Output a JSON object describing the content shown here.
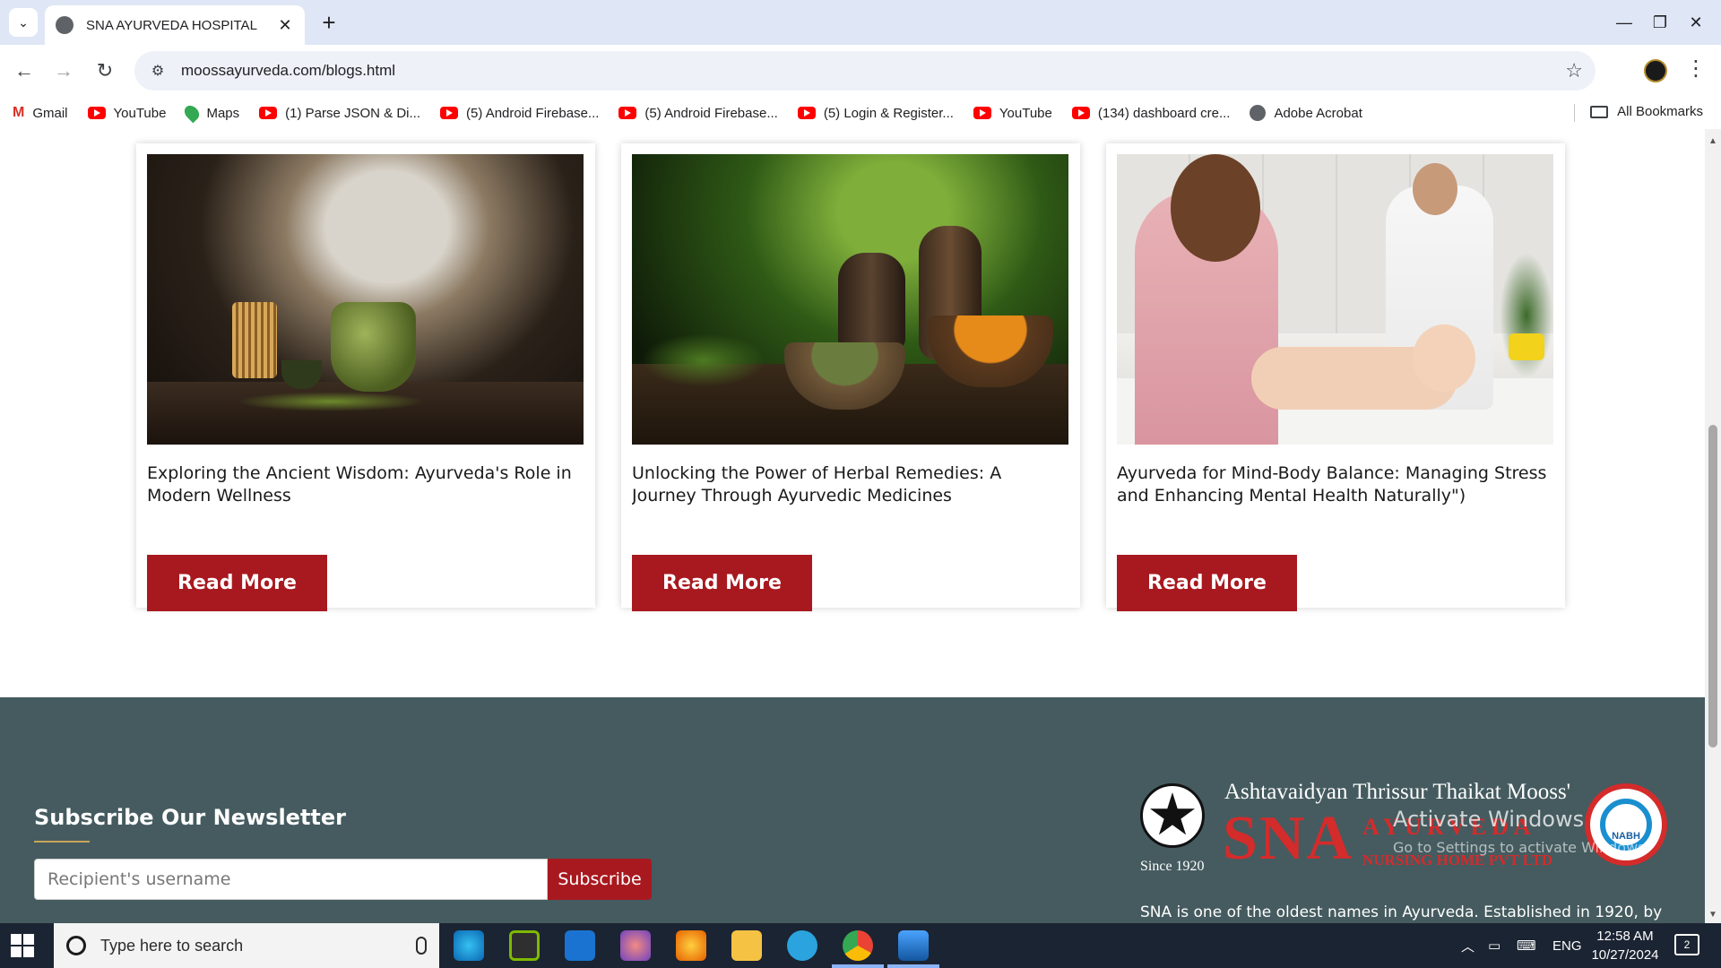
{
  "browser": {
    "tab_title": "SNA AYURVEDA HOSPITAL",
    "tab_close": "✕",
    "new_tab": "+",
    "url": "moossayurveda.com/blogs.html",
    "window_controls": {
      "minimize": "—",
      "restore": "❐",
      "close": "✕"
    },
    "bookmarks": [
      {
        "label": "Gmail",
        "icon": "gmail-icon"
      },
      {
        "label": "YouTube",
        "icon": "youtube-icon"
      },
      {
        "label": "Maps",
        "icon": "maps-icon"
      },
      {
        "label": "(1) Parse JSON & Di...",
        "icon": "youtube-icon"
      },
      {
        "label": "(5) Android Firebase...",
        "icon": "youtube-icon"
      },
      {
        "label": "(5) Android Firebase...",
        "icon": "youtube-icon"
      },
      {
        "label": "(5) Login & Register...",
        "icon": "youtube-icon"
      },
      {
        "label": "YouTube",
        "icon": "youtube-icon"
      },
      {
        "label": "(134) dashboard cre...",
        "icon": "youtube-icon"
      },
      {
        "label": "Adobe Acrobat",
        "icon": "globe-icon"
      }
    ],
    "all_bookmarks": "All Bookmarks"
  },
  "blog": {
    "cards": [
      {
        "title": "Exploring the Ancient Wisdom: Ayurveda's Role in Modern Wellness",
        "button": "Read More"
      },
      {
        "title": "Unlocking the Power of Herbal Remedies: A Journey Through Ayurvedic Medicines",
        "button": "Read More"
      },
      {
        "title": "Ayurveda for Mind-Body Balance: Managing Stress and Enhancing Mental Health Naturally\")",
        "button": "Read More"
      }
    ]
  },
  "footer": {
    "newsletter_title": "Subscribe Our Newsletter",
    "input_placeholder": "Recipient's username",
    "subscribe_button": "Subscribe",
    "logo": {
      "tagline": "Ashtavaidyan Thrissur Thaikat Mooss'",
      "main": "SNA",
      "sub1": "AYURVEDA",
      "sub2": "NURSING HOME PVT LTD",
      "since": "Since 1920",
      "badge": "NABH"
    },
    "description": "SNA is one of the oldest names in Ayurveda. Established in 1920, by",
    "watermark_title": "Activate Windows",
    "watermark_sub": "Go to Settings to activate Windows."
  },
  "taskbar": {
    "search_placeholder": "Type here to search",
    "language": "ENG",
    "time": "12:58 AM",
    "date": "10/27/2024",
    "notifications": "2"
  },
  "colors": {
    "accent_red": "#a8191f",
    "footer_bg": "#455b5f",
    "logo_red": "#d42b2b"
  }
}
